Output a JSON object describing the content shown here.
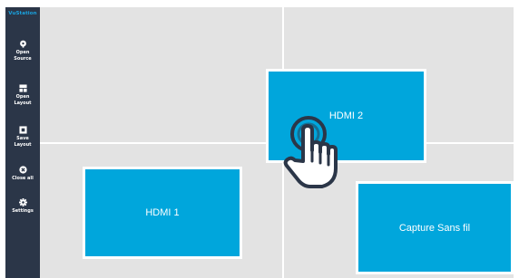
{
  "app": {
    "brand": "VuStation"
  },
  "sidebar": {
    "items": [
      {
        "icon": "source-icon",
        "label_line1": "Open",
        "label_line2": "Source"
      },
      {
        "icon": "layout-icon",
        "label_line1": "Open",
        "label_line2": "Layout"
      },
      {
        "icon": "save-icon",
        "label_line1": "Save",
        "label_line2": "Layout"
      },
      {
        "icon": "close-circle-icon",
        "label_line1": "Close all",
        "label_line2": ""
      },
      {
        "icon": "gear-icon",
        "label_line1": "Settings",
        "label_line2": ""
      }
    ]
  },
  "canvas": {
    "sources": [
      {
        "label": "HDMI 2"
      },
      {
        "label": "HDMI 1"
      },
      {
        "label": "Capture Sans fil"
      }
    ]
  },
  "colors": {
    "sidebar": "#2b3648",
    "brand": "#1aa3e0",
    "canvas": "#e3e3e3",
    "source": "#00a6dc"
  }
}
